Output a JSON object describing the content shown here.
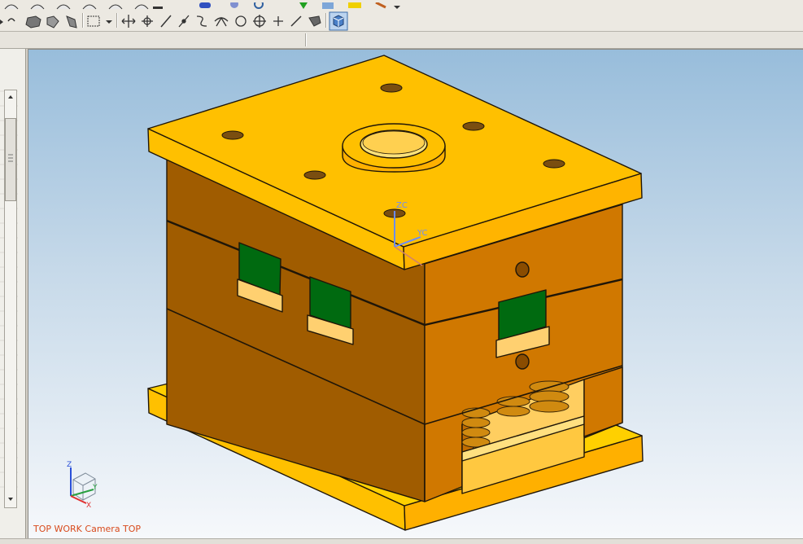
{
  "viewport": {
    "view_label": "TOP WORK Camera TOP",
    "background_top": "#98bddb",
    "background_bottom": "#f6f8fb"
  },
  "model": {
    "plate_color": "#ffc000",
    "side_color": "#d07800",
    "front_color": "#a05c00",
    "window_color": "#006a10",
    "edge_color": "#1f1608"
  },
  "datum_csys": {
    "z_label": "ZC",
    "y_label": "YC"
  },
  "view_triad": {
    "z_label": "Z",
    "y_label": "Y",
    "x_label": "X"
  },
  "toolbar": {
    "icons": [
      "move-object-icon",
      "rotate-object-icon",
      "line-icon",
      "arc-line-icon",
      "spline-icon",
      "fan-icon",
      "circle-icon",
      "crosshair-point-icon",
      "plus-icon",
      "line-tool-icon",
      "tool-bucket-icon",
      "view-cube-icon"
    ]
  }
}
